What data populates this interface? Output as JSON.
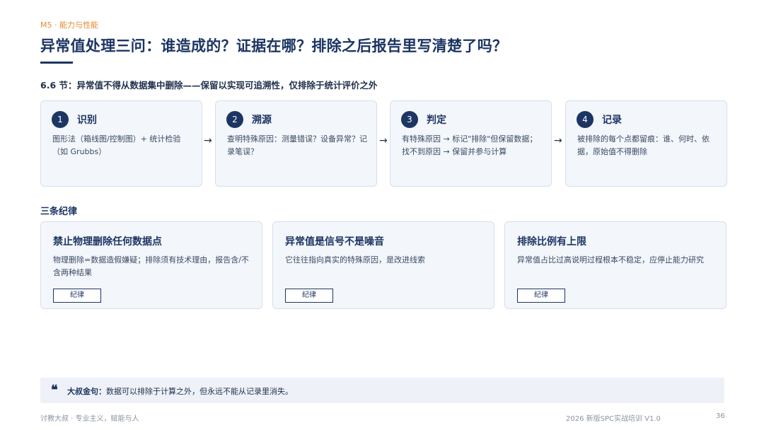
{
  "header": {
    "module_tag": "M5 · 能力与性能",
    "title": "异常值处理三问：谁造成的？证据在哪？排除之后报告里写清楚了吗？",
    "subtitle": "6.6 节：异常值不得从数据集中删除——保留以实现可追溯性，仅排除于统计评价之外"
  },
  "steps": [
    {
      "num": "1",
      "title": "识别",
      "desc": "图形法（箱线图/控制图）+ 统计检验（如 Grubbs）"
    },
    {
      "num": "2",
      "title": "溯源",
      "desc": "查明特殊原因：测量错误？设备异常？记录笔误？"
    },
    {
      "num": "3",
      "title": "判定",
      "desc": "有特殊原因 → 标记\"排除\"但保留数据；找不到原因 → 保留并参与计算"
    },
    {
      "num": "4",
      "title": "记录",
      "desc": "被排除的每个点都留痕：谁、何时、依据，原始值不得删除"
    }
  ],
  "arrow_glyph": "→",
  "rules_section": {
    "heading": "三条纪律",
    "items": [
      {
        "title": "禁止物理删除任何数据点",
        "desc": "物理删除=数据造假嫌疑；排除须有技术理由，报告含/不含两种结果",
        "tag": "纪律"
      },
      {
        "title": "异常值是信号不是噪音",
        "desc": "它往往指向真实的特殊原因，是改进线索",
        "tag": "纪律"
      },
      {
        "title": "排除比例有上限",
        "desc": "异常值占比过高说明过程根本不稳定，应停止能力研究",
        "tag": "纪律"
      }
    ]
  },
  "quote": {
    "mark": "❝",
    "label": "大叔金句：",
    "text": "数据可以排除于计算之外，但永远不能从记录里消失。"
  },
  "footer": {
    "left": "讨教大叔 · 专业主义，赋能与人",
    "right": "2026 新版SPC实战培训 V1.0",
    "page": "36"
  },
  "colors": {
    "accent": "#1c3563",
    "tag_orange": "#e88a2e",
    "card_bg": "#f3f6fb"
  }
}
